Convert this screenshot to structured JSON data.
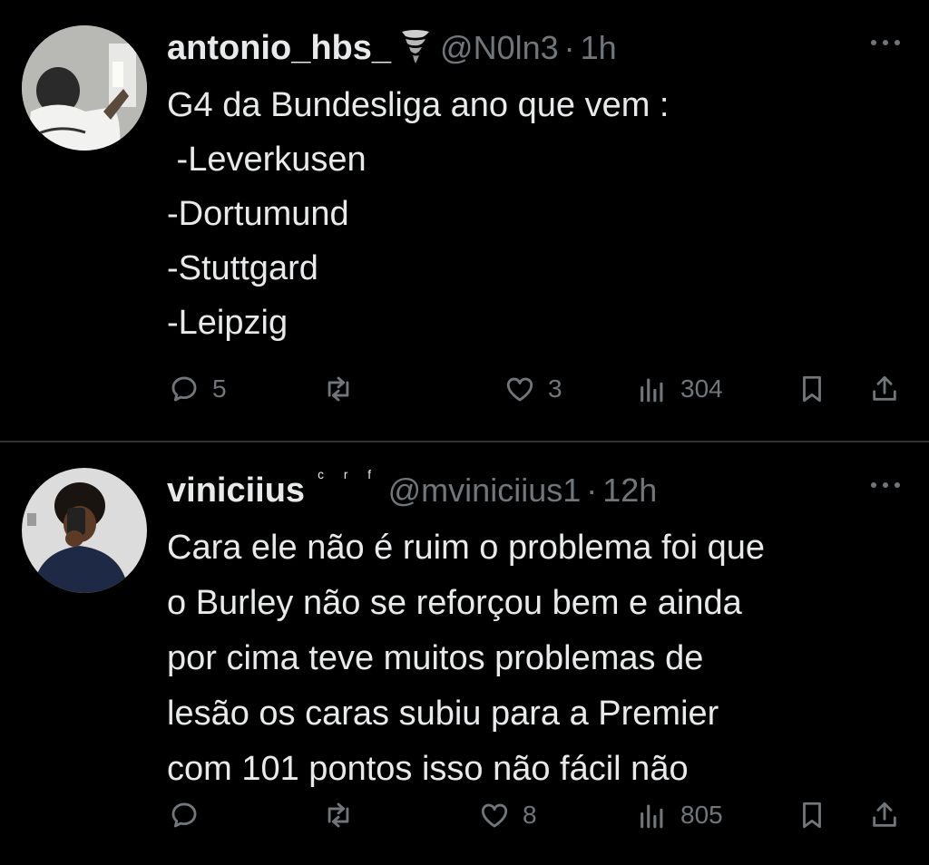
{
  "tweets": [
    {
      "author_name": "antonio_hbs_",
      "author_badge_icon": "tornado-icon",
      "handle": "@N0ln3",
      "separator": "·",
      "time": "1h",
      "text": "G4 da Bundesliga ano que vem :\n -Leverkusen\n-Dortumund\n-Stuttgard\n-Leipzig",
      "replies": "5",
      "reposts": "",
      "likes": "3",
      "views": "304"
    },
    {
      "author_name": "viniciius",
      "author_suffix": "ᶜ ʳ ᶠ",
      "handle": "@mviniciius1",
      "separator": "·",
      "time": "12h",
      "text": "Cara ele não é ruim o problema foi que\no Burley não se reforçou bem e ainda\npor cima teve muitos problemas de\nlesão os caras subiu para a Premier\ncom 101 pontos isso não fácil não",
      "replies": "",
      "reposts": "",
      "likes": "8",
      "views": "805"
    }
  ],
  "colors": {
    "background": "#000000",
    "text": "#e7e9ea",
    "muted": "#71767b",
    "divider": "#2f3336"
  }
}
